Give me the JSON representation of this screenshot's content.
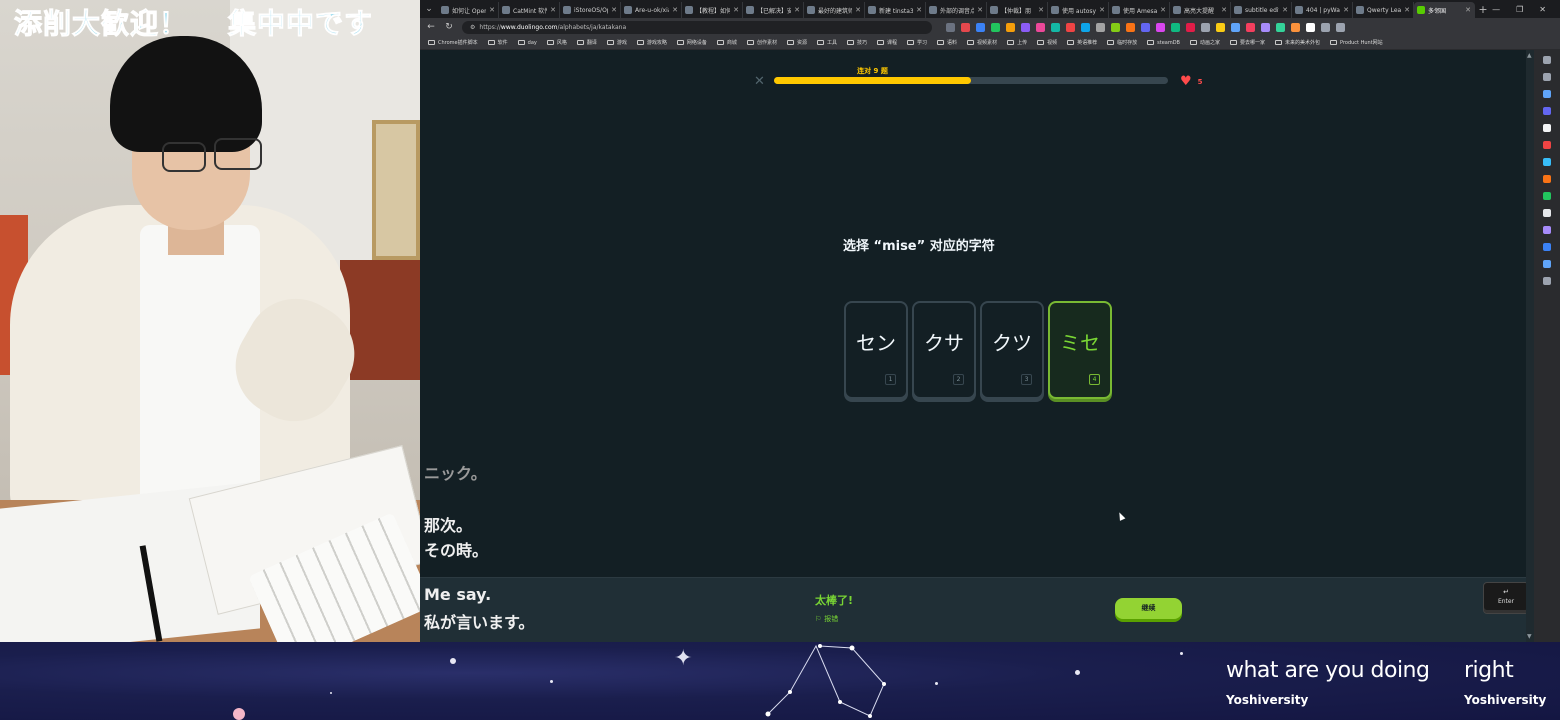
{
  "webcam": {
    "banner_left": "添削大歓迎！",
    "banner_right": "集中中です"
  },
  "browser": {
    "tabs": [
      {
        "title": "如何让 OpenAI"
      },
      {
        "title": "CatMint 软件"
      },
      {
        "title": "iStoreOS/Open"
      },
      {
        "title": "Are-u-ok/xiao"
      },
      {
        "title": "【教程】如何"
      },
      {
        "title": "【已解决】安"
      },
      {
        "title": "最好的建筑师"
      },
      {
        "title": "新建 tinsta360"
      },
      {
        "title": "外部的调音点"
      },
      {
        "title": "【仲裁】朋"
      },
      {
        "title": "使用 autosync"
      },
      {
        "title": "使用 Amesa"
      },
      {
        "title": "高亮大提醒"
      },
      {
        "title": "subtitle edit"
      },
      {
        "title": "404 | pyWav"
      },
      {
        "title": "Qwerty Learn"
      },
      {
        "title": "多邻国"
      }
    ],
    "url_prefix": "https://",
    "url_host": "www.duolingo.com",
    "url_path": "/alphabets/ja/katakana",
    "bookmarks": [
      "Chrome插件脚本",
      "软件",
      "day",
      "风格",
      "翻译",
      "游戏",
      "游戏攻略",
      "网络设备",
      "商城",
      "创作素材",
      "资源",
      "工具",
      "技巧",
      "课程",
      "学习",
      "语料",
      "视频素材",
      "上传",
      "视频",
      "英语推荐",
      "临时存放",
      "steamDB",
      "动画之家",
      "要去哪一家",
      "未来的美术外包",
      "Product Hunt网站"
    ]
  },
  "lesson": {
    "streak_label": "连对 9 题",
    "progress": 0.5,
    "hearts": "5",
    "prompt": "选择 “mise” 对应的字符",
    "choices": [
      {
        "glyph": "セン",
        "key": "1"
      },
      {
        "glyph": "クサ",
        "key": "2"
      },
      {
        "glyph": "クツ",
        "key": "3"
      },
      {
        "glyph": "ミセ",
        "key": "4"
      }
    ],
    "selected_index": 3,
    "feedback_title": "太棒了!",
    "feedback_report": "报错",
    "continue_label": "继续",
    "enter_label": "Enter"
  },
  "subtitles": {
    "faded_top": "ニック。",
    "line_1": "那次。",
    "line_2": "その時。",
    "line_3": "Me say.",
    "line_4": "私が言います。"
  },
  "overlay": {
    "lyric_main": "what are you doing",
    "lyric_side": "right",
    "credit_1": "Yoshiversity",
    "credit_2": "Yoshiversity"
  },
  "colors": {
    "duo_green": "#58cc02",
    "selected_green": "#79d634",
    "progress_yellow": "#ffc800",
    "heart_red": "#ff4b4b",
    "page_bg": "#131f24"
  }
}
